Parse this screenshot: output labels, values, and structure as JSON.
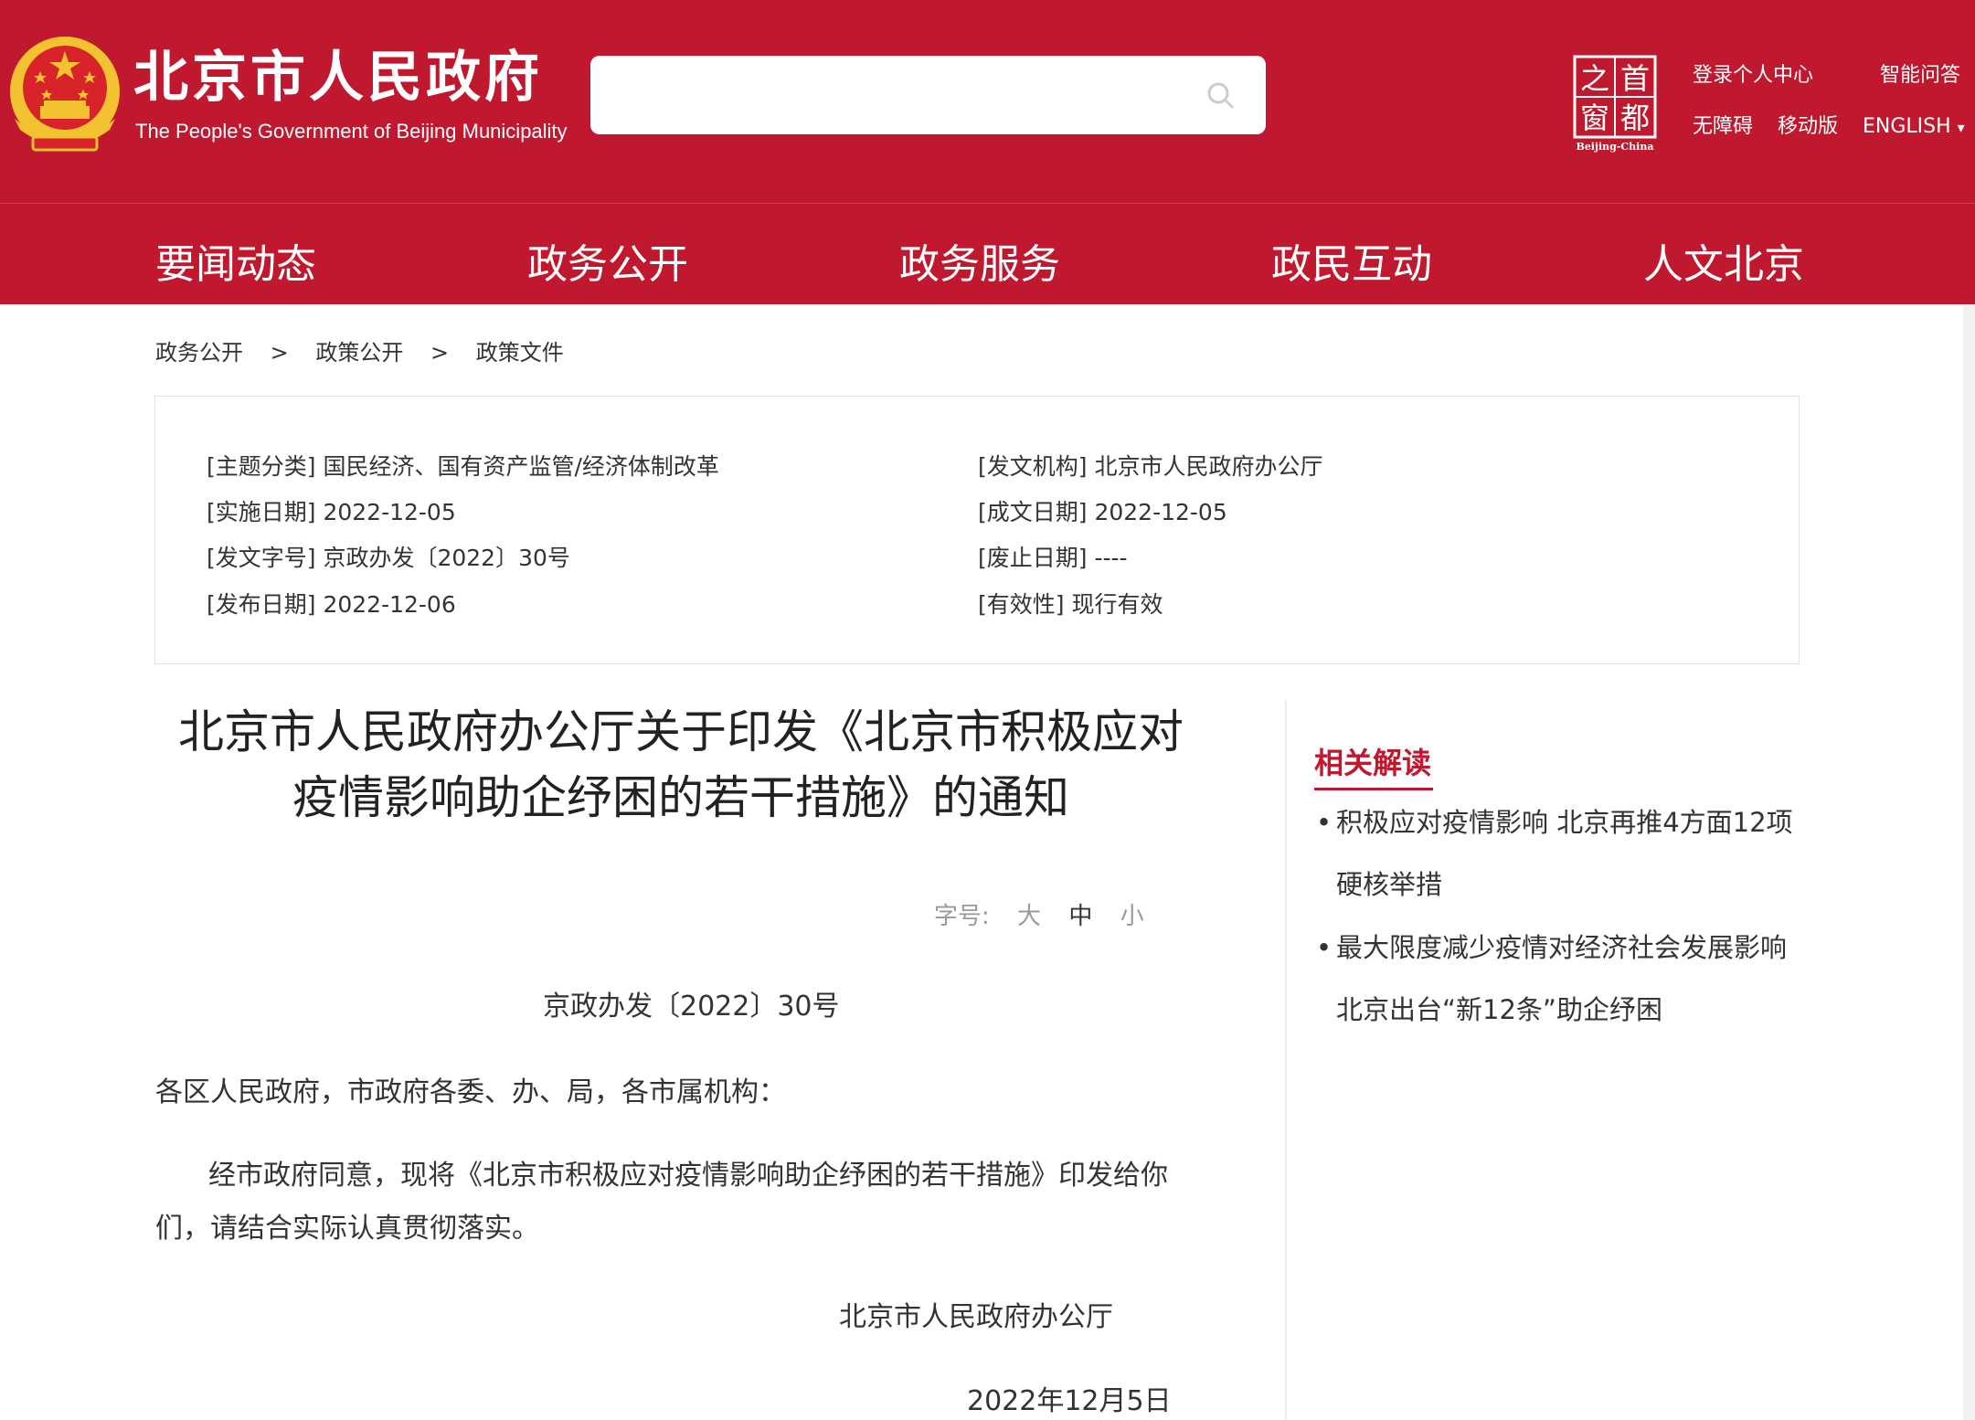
{
  "header": {
    "site_title": "北京市人民政府",
    "site_subtitle": "The People's Government of Beijing Municipality",
    "search": {
      "placeholder": ""
    },
    "capital_logo": {
      "chars": [
        "之",
        "首",
        "窗",
        "都"
      ],
      "caption": "Beijing-China"
    },
    "links": {
      "login": "登录个人中心",
      "smart_qa": "智能问答",
      "accessibility": "无障碍",
      "mobile": "移动版",
      "english": "ENGLISH",
      "english_arrow": "▾"
    }
  },
  "nav": {
    "items": [
      "要闻动态",
      "政务公开",
      "政务服务",
      "政民互动",
      "人文北京"
    ]
  },
  "breadcrumb": {
    "items": [
      "政务公开",
      "政策公开",
      "政策文件"
    ],
    "separator": ">"
  },
  "meta": {
    "topic": "[主题分类] 国民经济、国有资产监管/经济体制改革",
    "issuer": "[发文机构] 北京市人民政府办公厅",
    "effective_date": "[实施日期] 2022-12-05",
    "written_date": "[成文日期] 2022-12-05",
    "doc_number": "[发文字号] 京政办发〔2022〕30号",
    "repeal_date": "[废止日期] ----",
    "publish_date": "[发布日期] 2022-12-06",
    "validity": "[有效性] 现行有效"
  },
  "article": {
    "title_line1": "北京市人民政府办公厅关于印发《北京市积极应对",
    "title_line2": "疫情影响助企纾困的若干措施》的通知",
    "font_size_label": "字号:",
    "font_size_large": "大",
    "font_size_medium": "中",
    "font_size_small": "小",
    "doc_number": "京政办发〔2022〕30号",
    "recipients": "各区人民政府，市政府各委、办、局，各市属机构：",
    "body": "经市政府同意，现将《北京市积极应对疫情影响助企纾困的若干措施》印发给你们，请结合实际认真贯彻落实。",
    "signature_org": "北京市人民政府办公厅",
    "signature_date": "2022年12月5日"
  },
  "related": {
    "title": "相关解读",
    "bullet": "•",
    "items": [
      "积极应对疫情影响 北京再推4方面12项硬核举措",
      "最大限度减少疫情对经济社会发展影响 北京出台“新12条”助企纾困"
    ]
  },
  "colors": {
    "brand_red": "#c0182e",
    "emblem_gold": "#f2c230"
  }
}
